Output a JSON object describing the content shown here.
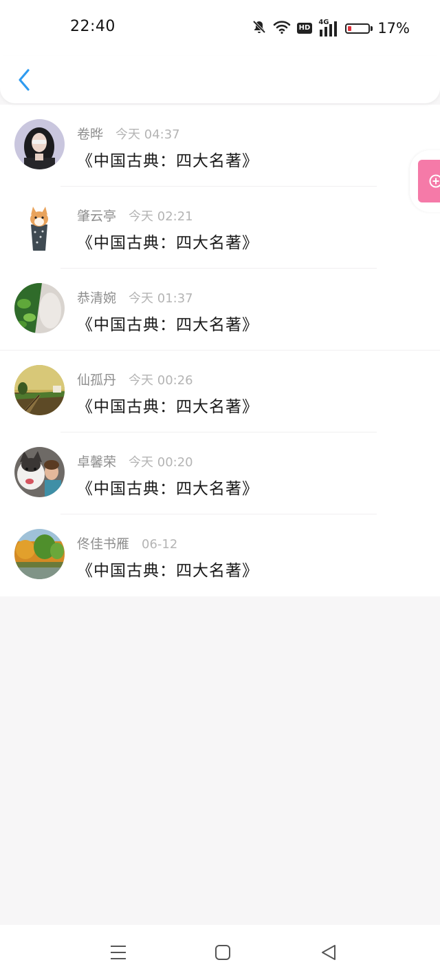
{
  "status_bar": {
    "time": "22:40",
    "icons": [
      "bell-muted-icon",
      "wifi-icon",
      "hd-icon",
      "signal-4g-icon",
      "battery-icon"
    ],
    "hd_label": "HD",
    "network_label": "4G",
    "battery_percent": "17%",
    "battery_level": 0.17,
    "battery_color": "#e0323c"
  },
  "nav": {
    "back_icon": "chevron-left-icon",
    "accent_color": "#2f9bf0"
  },
  "comments": [
    {
      "username": "卷晔",
      "time": "今天 04:37",
      "text": "《中国古典：四大名著》",
      "avatar": "avatar-girl-photo"
    },
    {
      "username": "肇云亭",
      "time": "今天 02:21",
      "text": "《中国古典：四大名著》",
      "avatar": "avatar-cat-photo"
    },
    {
      "username": "恭清婉",
      "time": "今天 01:37",
      "text": "《中国古典：四大名著》",
      "avatar": "avatar-leaves-photo"
    },
    {
      "username": "仙孤丹",
      "time": "今天 00:26",
      "text": "《中国古典：四大名著》",
      "avatar": "avatar-railway-photo"
    },
    {
      "username": "卓馨荣",
      "time": "今天 00:20",
      "text": "《中国古典：四大名著》",
      "avatar": "avatar-dog-photo"
    },
    {
      "username": "佟佳书雁",
      "time": "06-12",
      "text": "《中国古典：四大名著》",
      "avatar": "avatar-forest-photo"
    }
  ],
  "floating_button": {
    "icon": "plus-circle-icon",
    "color": "#f57aa8"
  },
  "system_nav": {
    "icons": [
      "menu-icon",
      "home-square-icon",
      "back-triangle-icon"
    ]
  }
}
